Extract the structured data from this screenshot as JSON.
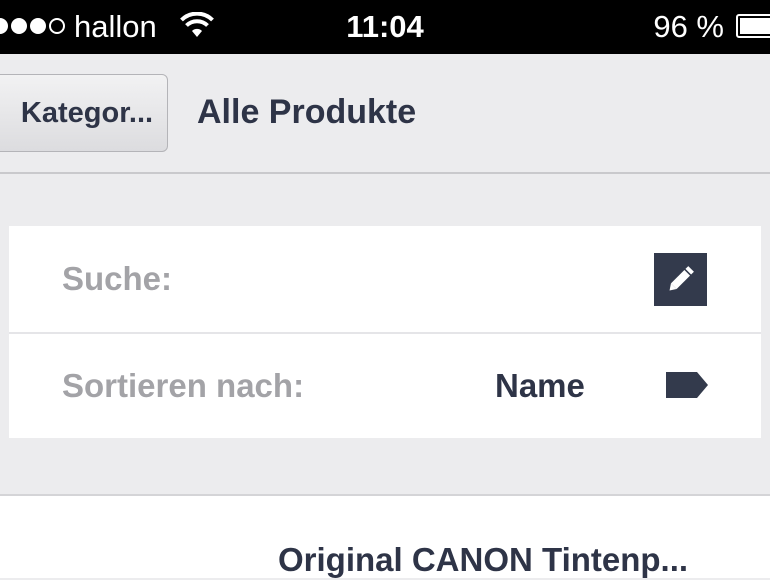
{
  "status_bar": {
    "carrier": "hallon",
    "time": "11:04",
    "battery_percent_text": "96 %",
    "battery_level": 0.96,
    "signal_bars_filled": 4,
    "signal_bars_total": 5
  },
  "nav": {
    "back_label": "Kategor...",
    "title": "Alle Produkte"
  },
  "filters": {
    "search_label": "Suche:",
    "sort_label": "Sortieren nach:",
    "sort_value": "Name"
  },
  "list": {
    "first_item": "Original CANON Tintenp..."
  },
  "colors": {
    "accent": "#333a4c",
    "text_dark": "#2e3447",
    "text_muted": "#a3a3a7",
    "background": "#ececee"
  },
  "icons": {
    "signal": "cellular-signal-icon",
    "wifi": "wifi-icon",
    "battery": "battery-icon",
    "search_edit": "pencil-icon",
    "sort": "tag-icon"
  }
}
